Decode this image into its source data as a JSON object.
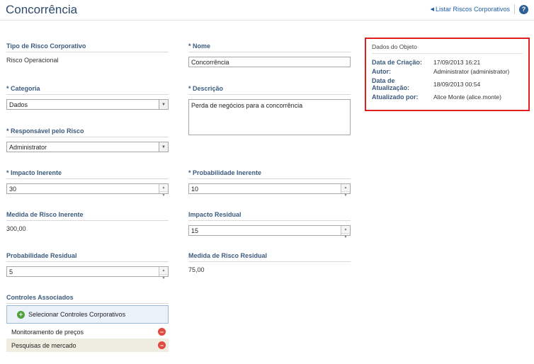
{
  "page": {
    "title": "Concorrência"
  },
  "top_links": {
    "list_label": "Listar Riscos Corporativos",
    "help_icon": "help-icon",
    "help_glyph": "?"
  },
  "fields": {
    "tipo": {
      "label": "Tipo de Risco Corporativo",
      "value": "Risco Operacional"
    },
    "nome": {
      "label": "Nome",
      "value": "Concorrência"
    },
    "categoria": {
      "label": "Categoria",
      "value": "Dados"
    },
    "descricao": {
      "label": "Descrição",
      "value": "Perda de negócios para a concorrência"
    },
    "responsavel": {
      "label": "Responsável pelo Risco",
      "value": "Administrator"
    },
    "impacto_inerente": {
      "label": "Impacto Inerente",
      "value": "30"
    },
    "probabilidade_inerente": {
      "label": "Probabilidade Inerente",
      "value": "10"
    },
    "medida_inerente": {
      "label": "Medida de Risco Inerente",
      "value": "300,00"
    },
    "impacto_residual": {
      "label": "Impacto Residual",
      "value": "15"
    },
    "probabilidade_residual": {
      "label": "Probabilidade Residual",
      "value": "5"
    },
    "medida_residual": {
      "label": "Medida de Risco Residual",
      "value": "75,00"
    }
  },
  "required_marker": "* ",
  "controls": {
    "label": "Controles Associados",
    "select_button": "Selecionar Controles Corporativos",
    "items": [
      {
        "name": "Monitoramento de preços"
      },
      {
        "name": "Pesquisas de mercado"
      }
    ]
  },
  "object_data": {
    "title": "Dados do Objeto",
    "rows": [
      {
        "key": "Data de Criação:",
        "value": "17/09/2013 16:21"
      },
      {
        "key": "Autor:",
        "value": "Administrator (administrator)"
      },
      {
        "key": "Data de Atualização:",
        "value": "18/09/2013 00:54"
      },
      {
        "key": "Atualizado por:",
        "value": "Alice Monte (alice.monte)"
      }
    ]
  },
  "colors": {
    "highlight_border": "#e01f1f",
    "label": "#3c5b7e",
    "link": "#1f5fa8"
  }
}
